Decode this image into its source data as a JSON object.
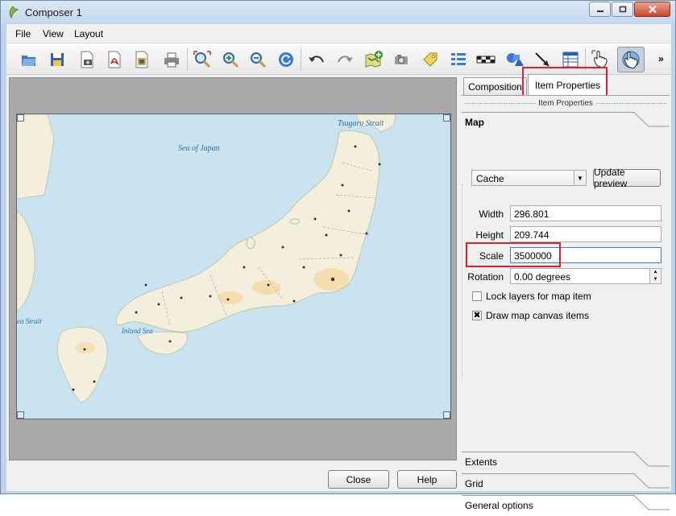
{
  "window": {
    "title": "Composer 1"
  },
  "menu": {
    "items": [
      "File",
      "View",
      "Layout"
    ]
  },
  "toolbar": {
    "icons": [
      "open-template-icon",
      "save-template-icon",
      "export-image-icon",
      "export-pdf-icon",
      "export-svg-icon",
      "print-icon",
      "zoom-full-icon",
      "zoom-in-icon",
      "zoom-out-icon",
      "refresh-icon",
      "undo-icon",
      "redo-icon",
      "add-map-icon",
      "add-image-icon",
      "add-label-icon",
      "add-legend-icon",
      "add-scalebar-icon",
      "add-shape-icon",
      "add-arrow-icon",
      "add-table-icon",
      "select-move-icon",
      "move-content-icon"
    ],
    "overflow": "»"
  },
  "tabs": {
    "composition": "Composition",
    "item_properties": "Item Properties"
  },
  "panel": {
    "subtitle": "Item Properties",
    "section_map": "Map",
    "cache_value": "Cache",
    "update_preview": "Update preview",
    "width_label": "Width",
    "width_value": "296.801",
    "height_label": "Height",
    "height_value": "209.744",
    "scale_label": "Scale",
    "scale_value": "3500000",
    "rotation_label": "Rotation",
    "rotation_value": "0.00 degrees",
    "lock_layers": "Lock layers for map item",
    "lock_layers_checked": false,
    "draw_canvas": "Draw map canvas items",
    "draw_canvas_checked": true,
    "check_mark": "✖",
    "sections": [
      "Extents",
      "Grid",
      "General options"
    ]
  },
  "buttons": {
    "close": "Close",
    "help": "Help"
  },
  "map": {
    "labels": {
      "sea_of_japan": "Sea of Japan",
      "tsugaru_strait": "Tsugaru Strait",
      "inland_sea": "Inland Sea",
      "korea_strait": "ea Strait"
    },
    "colors": {
      "water": "#c9e3f1",
      "land": "#f3efdc",
      "urban": "#f5d9a6"
    }
  },
  "colors": {
    "highlight": "#e0202a",
    "titlebar": "#c3d7ee"
  }
}
